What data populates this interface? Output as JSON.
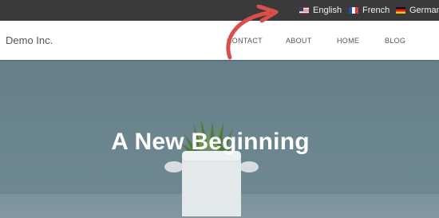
{
  "language_bar": {
    "languages": [
      {
        "label": "English",
        "flag": "flag-us-icon"
      },
      {
        "label": "French",
        "flag": "flag-fr-icon"
      },
      {
        "label": "German",
        "flag": "flag-de-icon"
      }
    ]
  },
  "header": {
    "brand": "Demo Inc.",
    "nav": [
      "CONTACT",
      "ABOUT",
      "HOME",
      "BLOG"
    ]
  },
  "hero": {
    "title": "A New Beginning"
  },
  "colors": {
    "topbar": "#3a3a3a",
    "header_bg": "#ffffff",
    "hero_bg": "#6c8690",
    "arrow": "#d9504a"
  }
}
